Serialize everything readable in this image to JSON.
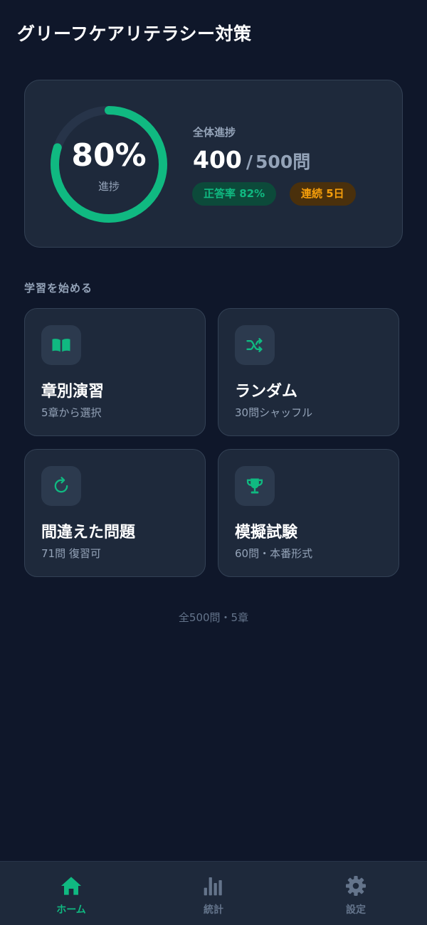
{
  "app": {
    "title": "グリーフケアリテラシー対策"
  },
  "progress": {
    "percent_text": "80%",
    "percent_value": 0.8,
    "caption": "進捗",
    "overall_label": "全体進捗",
    "done": "400",
    "separator": "/",
    "total": "500問",
    "badges": {
      "accuracy": "正答率 82%",
      "streak": "連続 5日"
    }
  },
  "section": {
    "start_label": "学習を始める"
  },
  "modes": [
    {
      "title": "章別演習",
      "subtitle": "5章から選択",
      "icon": "book-open-icon"
    },
    {
      "title": "ランダム",
      "subtitle": "30問シャッフル",
      "icon": "shuffle-icon"
    },
    {
      "title": "間違えた問題",
      "subtitle": "71問 復習可",
      "icon": "retry-icon"
    },
    {
      "title": "模擬試験",
      "subtitle": "60問・本番形式",
      "icon": "trophy-icon"
    }
  ],
  "footer": {
    "note": "全500問・5章"
  },
  "nav": [
    {
      "label": "ホーム",
      "icon": "home-icon",
      "active": true
    },
    {
      "label": "統計",
      "icon": "bar-chart-icon",
      "active": false
    },
    {
      "label": "設定",
      "icon": "gear-icon",
      "active": false
    }
  ],
  "colors": {
    "background": "#0f172a",
    "card": "#1e293b",
    "accent_green": "#10b981",
    "accent_amber": "#f59e0b",
    "muted_text": "#94a3b8",
    "inactive_nav": "#64748b"
  }
}
